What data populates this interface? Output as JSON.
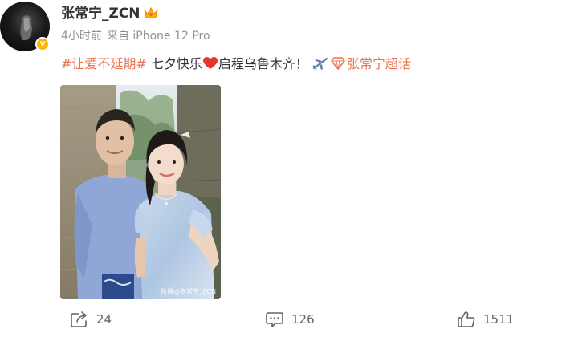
{
  "user": {
    "name": "张常宁_ZCN",
    "time": "4小时前",
    "source": "来自 iPhone 12 Pro",
    "verified_icon": "verified-badge-icon",
    "crown_icon": "crown-icon"
  },
  "post": {
    "hashtag": "#让爱不延期#",
    "text_before": " 七夕快乐",
    "text_after": "启程乌鲁木齐！",
    "supertopic": "张常宁超话"
  },
  "photo": {
    "watermark": "微博@张常宁_ZCN"
  },
  "actions": {
    "share": "24",
    "comment": "126",
    "like": "1511"
  },
  "colors": {
    "accent": "#eb7350",
    "heart": "#e8352c",
    "verified": "#ffb400",
    "meta": "#939393"
  }
}
